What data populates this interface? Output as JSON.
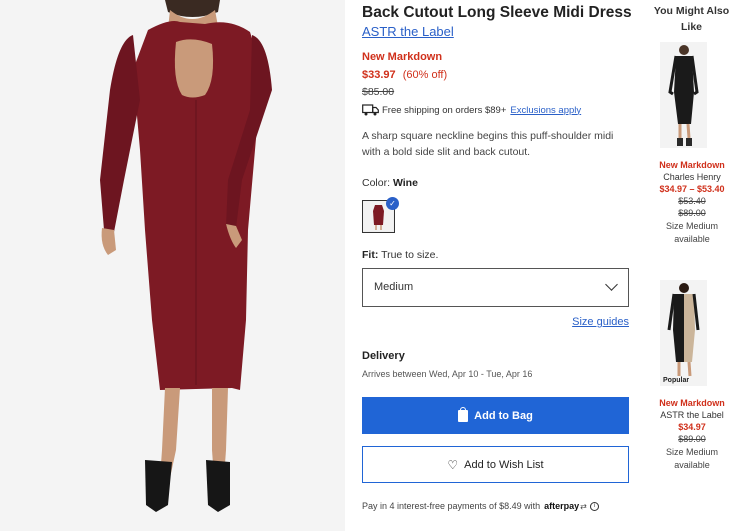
{
  "product": {
    "title": "Back Cutout Long Sleeve Midi Dress",
    "brand": "ASTR the Label",
    "markdown_label": "New Markdown",
    "sale_price": "$33.97",
    "discount": "(60% off)",
    "original_price": "$85.00",
    "shipping_text": "Free shipping on orders $89+",
    "exclusions_link": "Exclusions apply",
    "description": "A sharp square neckline begins this puff-shoulder midi with a bold side slit and back cutout.",
    "color_label": "Color:",
    "color_value": "Wine",
    "fit_label": "Fit:",
    "fit_value": "True to size.",
    "selected_size": "Medium",
    "size_guides": "Size guides",
    "delivery_heading": "Delivery",
    "delivery_text": "Arrives between Wed, Apr 10 - Tue, Apr 16",
    "add_to_bag": "Add to Bag",
    "add_to_wishlist": "Add to Wish List",
    "afterpay_text": "Pay in 4 interest-free payments of $8.49 with",
    "afterpay_brand": "afterpay"
  },
  "recommendations": {
    "heading": "You Might Also Like",
    "items": [
      {
        "markdown": "New Markdown",
        "brand": "Charles Henry",
        "price": "$34.97 – $53.40",
        "orig1": "$53.40",
        "orig2": "$89.00",
        "size_note": "Size Medium available"
      },
      {
        "badge": "Popular",
        "markdown": "New Markdown",
        "brand": "ASTR the Label",
        "price": "$34.97",
        "orig1": "$89.00",
        "size_note": "Size Medium available"
      }
    ]
  },
  "colors": {
    "accent": "#2065d6",
    "sale": "#d0301b",
    "dress": "#7d1a24"
  }
}
